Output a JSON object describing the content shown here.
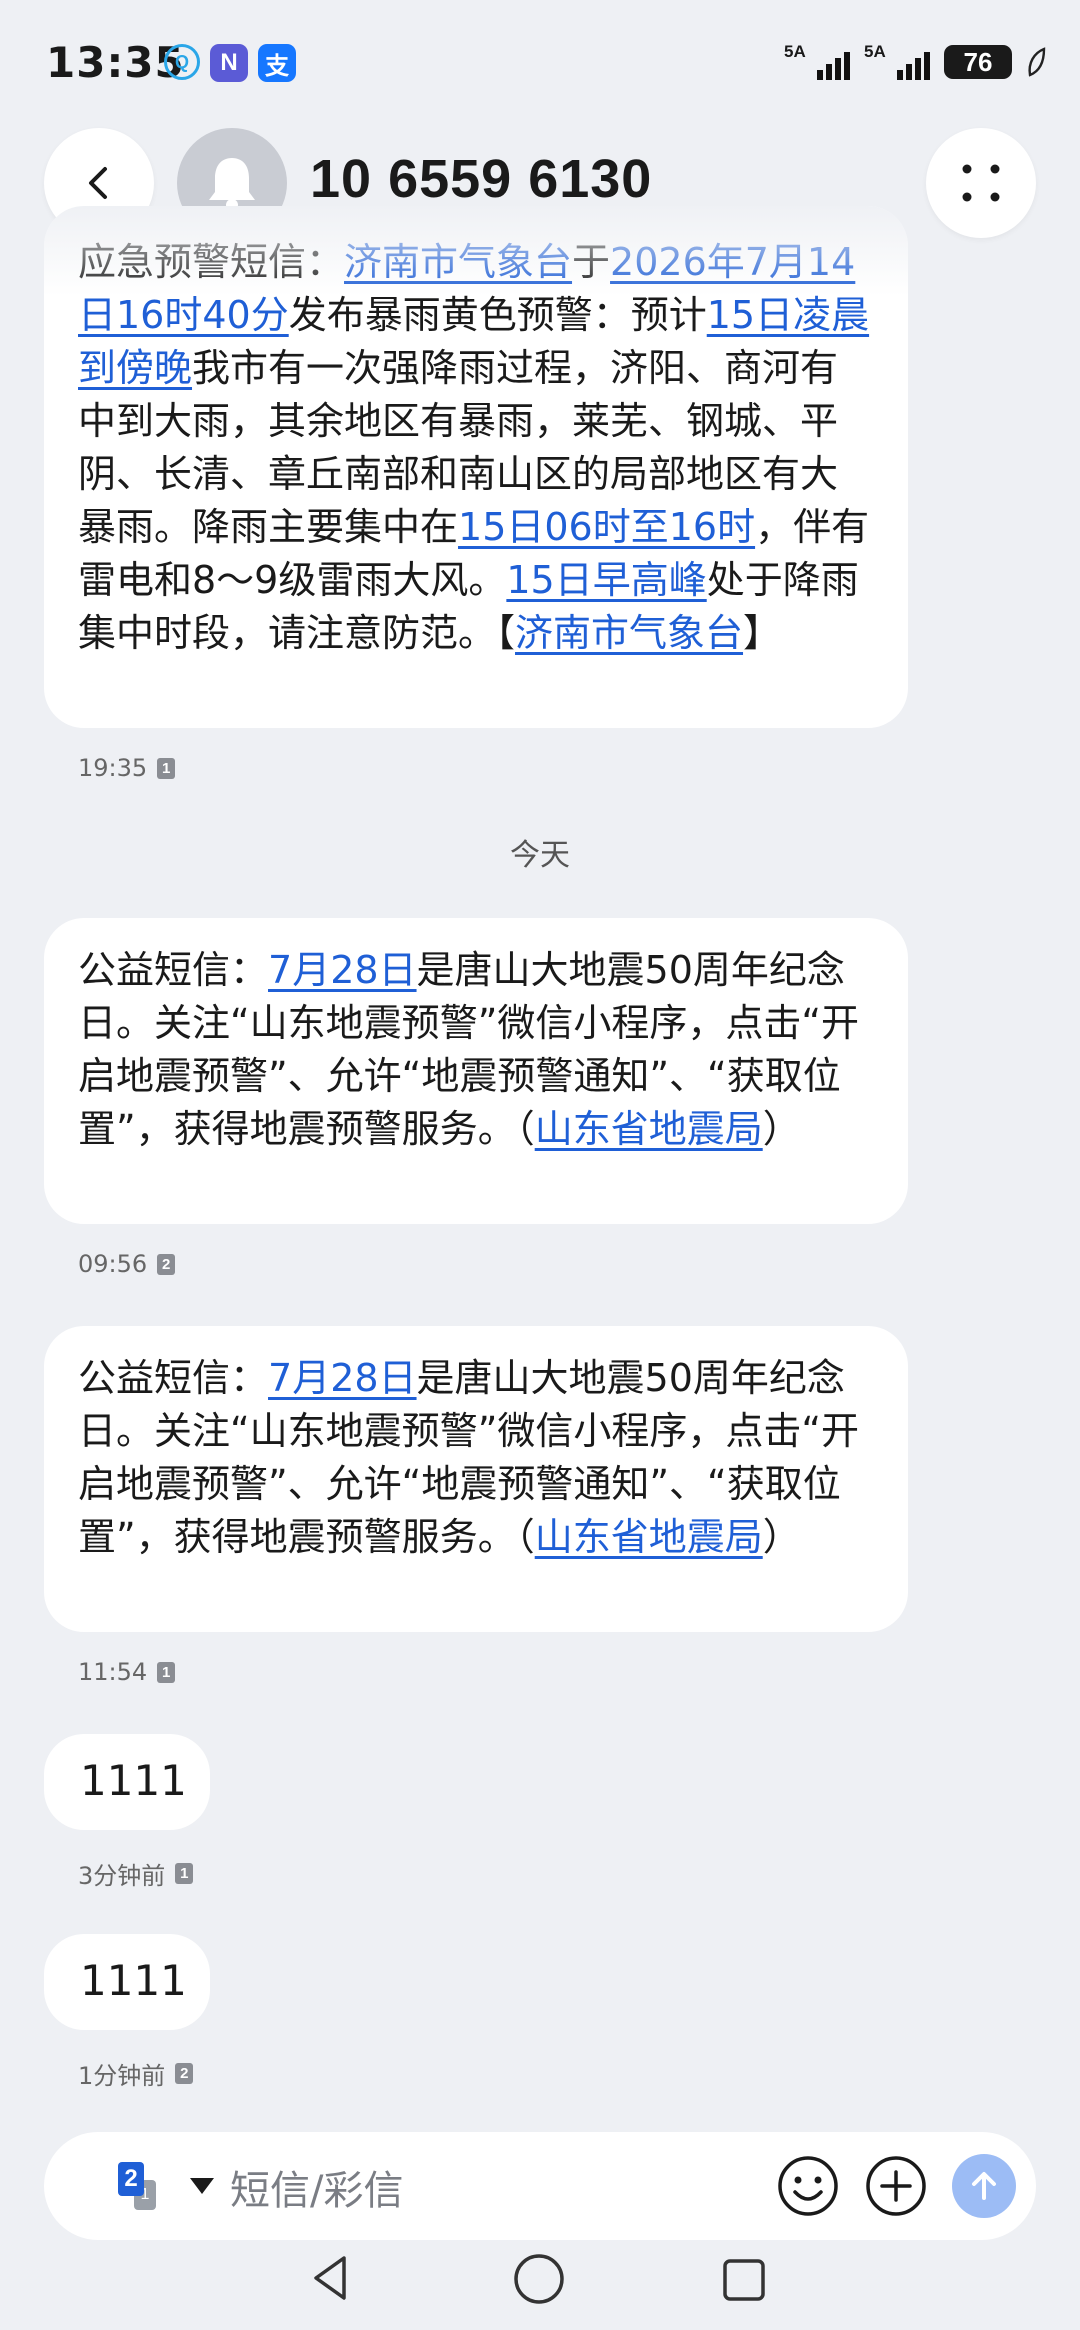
{
  "status_bar": {
    "time": "13:35",
    "apps": [
      "Q",
      "N",
      "支"
    ],
    "signal_1": "5A",
    "signal_2": "5A",
    "battery": "76"
  },
  "header": {
    "title": "10 6559 6130",
    "back_icon": "chevron-left-icon",
    "avatar_icon": "bell-icon",
    "more_icon": "more-dots-icon"
  },
  "messages": [
    {
      "parts": [
        {
          "text": "应急预警短信：",
          "link": false
        },
        {
          "text": "济南市气象台",
          "link": true
        },
        {
          "text": "于",
          "link": false
        },
        {
          "text": "2026年7月14日16时40分",
          "link": true
        },
        {
          "text": "发布暴雨黄色预警：预计",
          "link": false
        },
        {
          "text": "15日凌晨到傍晚",
          "link": true
        },
        {
          "text": "我市有一次强降雨过程，济阳、商河有中到大雨，其余地区有暴雨，莱芜、钢城、平阴、长清、章丘南部和南山区的局部地区有大暴雨。降雨主要集中在",
          "link": false
        },
        {
          "text": "15日06时至16时",
          "link": true
        },
        {
          "text": "，伴有雷电和8～9级雷雨大风。",
          "link": false
        },
        {
          "text": "15日早高峰",
          "link": true
        },
        {
          "text": "处于降雨集中时段，请注意防范。【",
          "link": false
        },
        {
          "text": "济南市气象台",
          "link": true
        },
        {
          "text": "】",
          "link": false
        }
      ],
      "time": "19:35",
      "sim": "1"
    },
    {
      "parts": [
        {
          "text": "公益短信：",
          "link": false
        },
        {
          "text": "7月28日",
          "link": true
        },
        {
          "text": "是唐山大地震50周年纪念日。关注“山东地震预警”微信小程序，点击“开启地震预警”、允许“地震预警通知”、“获取位置”，获得地震预警服务。（",
          "link": false
        },
        {
          "text": "山东省地震局",
          "link": true
        },
        {
          "text": "）",
          "link": false
        }
      ],
      "time": "09:56",
      "sim": "2"
    },
    {
      "parts": [
        {
          "text": "公益短信：",
          "link": false
        },
        {
          "text": "7月28日",
          "link": true
        },
        {
          "text": "是唐山大地震50周年纪念日。关注“山东地震预警”微信小程序，点击“开启地震预警”、允许“地震预警通知”、“获取位置”，获得地震预警服务。（",
          "link": false
        },
        {
          "text": "山东省地震局",
          "link": true
        },
        {
          "text": "）",
          "link": false
        }
      ],
      "time": "11:54",
      "sim": "1"
    },
    {
      "parts": [
        {
          "text": "1111",
          "link": false
        }
      ],
      "time": "3分钟前",
      "sim": "1"
    },
    {
      "parts": [
        {
          "text": "1111",
          "link": false
        }
      ],
      "time": "1分钟前",
      "sim": "2"
    }
  ],
  "date_separator": "今天",
  "composer": {
    "sim_primary": "2",
    "sim_secondary": "1",
    "placeholder": "短信/彩信",
    "emoji_icon": "emoji-icon",
    "plus_icon": "plus-icon",
    "send_icon": "send-arrow-icon",
    "send_color": "#9cbcf5"
  },
  "nav": {
    "back_icon": "nav-back-triangle-icon",
    "home_icon": "nav-home-circle-icon",
    "recent_icon": "nav-recent-square-icon"
  },
  "colors": {
    "background": "#eef0f4",
    "bubble": "#ffffff",
    "link": "#1f5fd6"
  }
}
